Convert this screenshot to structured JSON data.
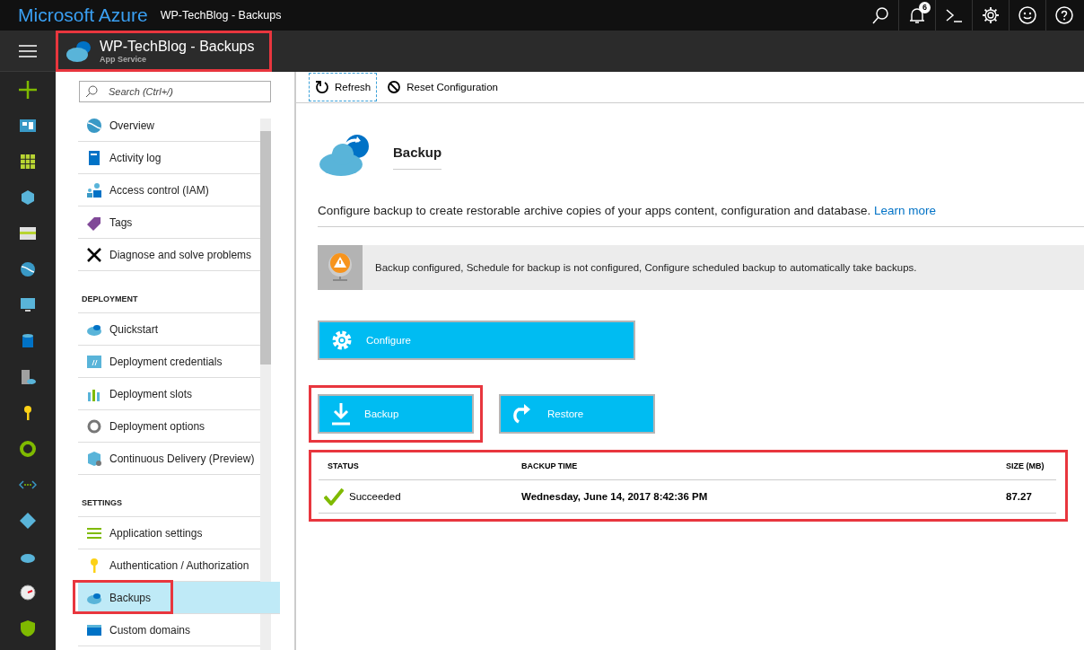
{
  "topbar": {
    "brand": "Microsoft Azure",
    "title": "WP-TechBlog - Backups",
    "notification_count": "6"
  },
  "blade_header": {
    "title": "WP-TechBlog - Backups",
    "subtitle": "App Service",
    "highlighted": true
  },
  "menu": {
    "search_placeholder": "Search (Ctrl+/)",
    "sections": [
      {
        "items": [
          {
            "label": "Overview",
            "selected": false,
            "highlighted": false
          },
          {
            "label": "Activity log",
            "selected": false,
            "highlighted": false
          },
          {
            "label": "Access control (IAM)",
            "selected": false,
            "highlighted": false
          },
          {
            "label": "Tags",
            "selected": false,
            "highlighted": false
          },
          {
            "label": "Diagnose and solve problems",
            "selected": false,
            "highlighted": false
          }
        ]
      },
      {
        "heading": "DEPLOYMENT",
        "items": [
          {
            "label": "Quickstart",
            "selected": false,
            "highlighted": false
          },
          {
            "label": "Deployment credentials",
            "selected": false,
            "highlighted": false
          },
          {
            "label": "Deployment slots",
            "selected": false,
            "highlighted": false
          },
          {
            "label": "Deployment options",
            "selected": false,
            "highlighted": false
          },
          {
            "label": "Continuous Delivery (Preview)",
            "selected": false,
            "highlighted": false
          }
        ]
      },
      {
        "heading": "SETTINGS",
        "items": [
          {
            "label": "Application settings",
            "selected": false,
            "highlighted": false
          },
          {
            "label": "Authentication / Authorization",
            "selected": false,
            "highlighted": false
          },
          {
            "label": "Backups",
            "selected": true,
            "highlighted": true
          },
          {
            "label": "Custom domains",
            "selected": false,
            "highlighted": false
          }
        ]
      }
    ]
  },
  "toolbar": [
    {
      "label": "Refresh",
      "kind": "refresh",
      "focused": true
    },
    {
      "label": "Reset Configuration",
      "kind": "reset",
      "focused": false
    }
  ],
  "content": {
    "title": "Backup",
    "description": "Configure backup to create restorable archive copies of your apps content, configuration and database.",
    "learn_more": "Learn more",
    "warning": "Backup configured, Schedule for backup is not configured, Configure scheduled backup to automatically take backups.",
    "configure_button": "Configure",
    "actions": [
      {
        "label": "Backup",
        "kind": "backup",
        "highlighted": true
      },
      {
        "label": "Restore",
        "kind": "restore",
        "highlighted": false
      }
    ]
  },
  "table": {
    "highlighted": true,
    "columns": [
      "STATUS",
      "BACKUP TIME",
      "SIZE (MB)"
    ],
    "rows": [
      {
        "status": "Succeeded",
        "backup_time": "Wednesday, June 14, 2017 8:42:36 PM",
        "size": "87.27"
      }
    ]
  }
}
